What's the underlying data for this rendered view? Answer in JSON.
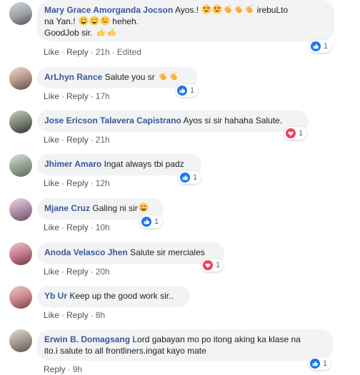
{
  "comments": [
    {
      "author": "Mary Grace Amorganda Jocson",
      "text1": "Ayos.!",
      "text1b": "irebuLto",
      "text2a": "na Yan.!",
      "text2b": "heheh.",
      "text3": "GoodJob sir.",
      "like": "Like",
      "reply": "Reply",
      "time": "21h",
      "edited": "Edited",
      "reaction": "like",
      "count": "1"
    },
    {
      "author": "ArLhyn Rance",
      "text": "Salute you sr",
      "like": "Like",
      "reply": "Reply",
      "time": "17h",
      "reaction": "like",
      "count": "1"
    },
    {
      "author": "Jose Ericson Talavera Capistrano",
      "text": "Ayos si sir hahaha Salute.",
      "like": "Like",
      "reply": "Reply",
      "time": "21h",
      "reaction": "love",
      "count": "1"
    },
    {
      "author": "Jhimer Amaro",
      "text": "Ingat always tbi padz",
      "like": "Like",
      "reply": "Reply",
      "time": "12h",
      "reaction": "like",
      "count": "1"
    },
    {
      "author": "Mjane Cruz",
      "text": "Galing ni sir",
      "like": "Like",
      "reply": "Reply",
      "time": "10h",
      "reaction": "like",
      "count": "1"
    },
    {
      "author": "Anoda Velasco Jhen",
      "text": "Salute sir merciales",
      "like": "Like",
      "reply": "Reply",
      "time": "20h",
      "reaction": "love",
      "count": "1"
    },
    {
      "author": "Yb Ur",
      "text": "Keep up the good work sir..",
      "like": "Like",
      "reply": "Reply",
      "time": "8h"
    },
    {
      "author": "Erwin B. Domagsang",
      "text": "Lord gabayan mo po itong aking ka klase na",
      "text2": "ito.i salute to all frontliners.ingat kayo mate",
      "reply": "Reply",
      "time": "9h",
      "reaction": "like",
      "count": "1"
    }
  ],
  "colors": {
    "link": "#385898",
    "like_blue": "#1877f2",
    "love_red": "#f33e58",
    "bubble": "#f2f3f5"
  }
}
